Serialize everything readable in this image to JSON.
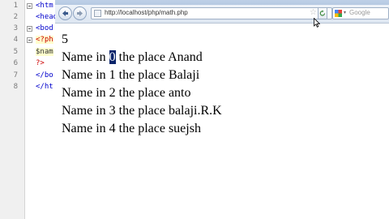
{
  "editor": {
    "line_numbers": [
      "1",
      "2",
      "3",
      "4",
      "5",
      "6",
      "7",
      "8"
    ],
    "lines": [
      {
        "text": "<htm",
        "kind": "tag"
      },
      {
        "text": "<head",
        "kind": "tag"
      },
      {
        "text": "<bod",
        "kind": "tag"
      },
      {
        "text": "<?ph",
        "kind": "php"
      },
      {
        "text": "$nam",
        "kind": "var"
      },
      {
        "text": "?>",
        "kind": "php"
      },
      {
        "text": "</bo",
        "kind": "tag"
      },
      {
        "text": "</ht",
        "kind": "tag"
      }
    ]
  },
  "browser": {
    "url": "http://localhost/php/math.php",
    "search_placeholder": "Google",
    "content": {
      "count": "5",
      "rows": [
        {
          "prefix": "Name in ",
          "index": "0",
          "suffix": " the place Anand"
        },
        {
          "prefix": "Name in ",
          "index": "1",
          "suffix": " the place Balaji"
        },
        {
          "prefix": "Name in ",
          "index": "2",
          "suffix": " the place anto"
        },
        {
          "prefix": "Name in ",
          "index": "3",
          "suffix": " the place balaji.R.K"
        },
        {
          "prefix": "Name in ",
          "index": "4",
          "suffix": " the place suejsh"
        }
      ]
    }
  },
  "icons": {
    "back": "back-arrow-icon",
    "forward": "forward-arrow-icon",
    "page": "page-icon",
    "bookmark": "star-icon",
    "reload": "reload-icon",
    "search_engine": "google-icon"
  },
  "colors": {
    "selection": "#0a246a",
    "html_tag": "#0000cc",
    "php_tag": "#cc0000"
  }
}
